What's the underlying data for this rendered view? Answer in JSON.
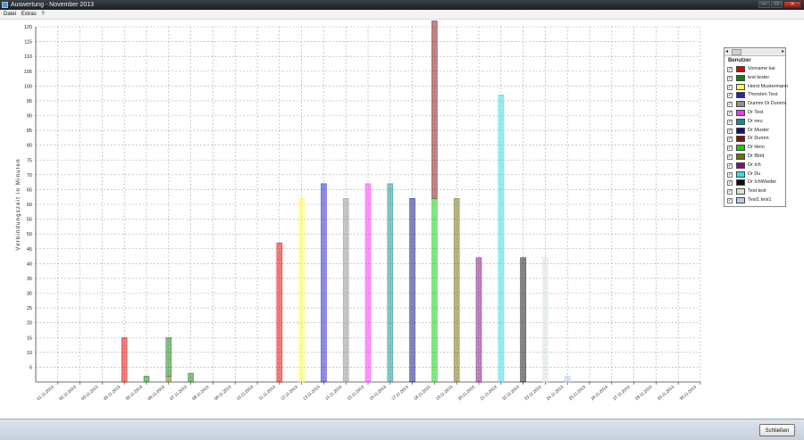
{
  "window": {
    "title": "Auswertung - November 2013",
    "buttons": {
      "minimize": "–",
      "maximize": "□",
      "close": "✕"
    }
  },
  "menu": {
    "items": [
      "Datei",
      "Extras",
      "?"
    ]
  },
  "legend": {
    "title": "Benutzer",
    "check_mark": "✓",
    "left_arrow": "◂",
    "right_arrow": "▸",
    "items": [
      {
        "name": "Vorname kai",
        "color": "#e00000"
      },
      {
        "name": "test tester",
        "color": "#108010"
      },
      {
        "name": "Horst Mustermann",
        "color": "#ffff40"
      },
      {
        "name": "Thorsten Test",
        "color": "#2020d0"
      },
      {
        "name": "Dummi Di Dummi",
        "color": "#909090"
      },
      {
        "name": "Dr Test",
        "color": "#ff30ff"
      },
      {
        "name": "Dr neu",
        "color": "#109090"
      },
      {
        "name": "Dr Muster",
        "color": "#101080"
      },
      {
        "name": "Dr Dumm",
        "color": "#801010"
      },
      {
        "name": "Dr Hein",
        "color": "#10d010"
      },
      {
        "name": "Dr Blöd",
        "color": "#707010"
      },
      {
        "name": "Dr Ich",
        "color": "#801080"
      },
      {
        "name": "Dr Du",
        "color": "#30e0e0"
      },
      {
        "name": "Dr IchWieder",
        "color": "#101010"
      },
      {
        "name": "Test test",
        "color": "#d8e4d8"
      },
      {
        "name": "Test1 test1",
        "color": "#b8cce8"
      }
    ]
  },
  "footer": {
    "close_label": "Schließen"
  },
  "chart_data": {
    "type": "bar",
    "stacked": true,
    "ylabel": "Verbindungszeit in Minuten",
    "xlabel": "",
    "ylim": [
      0,
      120
    ],
    "yticks": [
      5,
      10,
      15,
      20,
      25,
      30,
      35,
      40,
      45,
      50,
      55,
      60,
      65,
      70,
      75,
      80,
      85,
      90,
      95,
      100,
      105,
      110,
      115,
      120
    ],
    "grid": true,
    "legend_position": "right",
    "categories": [
      "01.11.2013",
      "02.11.2013",
      "03.11.2013",
      "04.11.2013",
      "05.11.2013",
      "06.11.2013",
      "07.11.2013",
      "08.11.2013",
      "09.11.2013",
      "10.11.2013",
      "11.11.2013",
      "12.11.2013",
      "13.11.2013",
      "14.11.2013",
      "15.11.2013",
      "16.11.2013",
      "17.11.2013",
      "18.11.2013",
      "19.11.2013",
      "20.11.2013",
      "21.11.2013",
      "22.11.2013",
      "23.11.2013",
      "24.11.2013",
      "25.11.2013",
      "26.11.2013",
      "27.11.2013",
      "28.11.2013",
      "29.11.2013",
      "30.11.2013"
    ],
    "bars": [
      {
        "date": "04.11.2013",
        "segments": [
          {
            "series": "Vorname kai",
            "value": 15
          }
        ]
      },
      {
        "date": "05.11.2013",
        "segments": [
          {
            "series": "test tester",
            "value": 2
          }
        ]
      },
      {
        "date": "06.11.2013",
        "segments": [
          {
            "series": "Dr Blöd",
            "value": 2
          },
          {
            "series": "test tester",
            "value": 13
          }
        ]
      },
      {
        "date": "07.11.2013",
        "segments": [
          {
            "series": "test tester",
            "value": 3
          }
        ]
      },
      {
        "date": "11.11.2013",
        "segments": [
          {
            "series": "Vorname kai",
            "value": 47
          }
        ]
      },
      {
        "date": "12.11.2013",
        "segments": [
          {
            "series": "Horst Mustermann",
            "value": 62
          }
        ]
      },
      {
        "date": "13.11.2013",
        "segments": [
          {
            "series": "Thorsten Test",
            "value": 67
          }
        ]
      },
      {
        "date": "14.11.2013",
        "segments": [
          {
            "series": "Dummi Di Dummi",
            "value": 62
          }
        ]
      },
      {
        "date": "15.11.2013",
        "segments": [
          {
            "series": "Dr Test",
            "value": 67
          }
        ]
      },
      {
        "date": "16.11.2013",
        "segments": [
          {
            "series": "Dr neu",
            "value": 67
          }
        ]
      },
      {
        "date": "17.11.2013",
        "segments": [
          {
            "series": "Dr Muster",
            "value": 62
          }
        ]
      },
      {
        "date": "18.11.2013",
        "segments": [
          {
            "series": "Dr Hein",
            "value": 62
          },
          {
            "series": "Dr Dumm",
            "value": 60
          }
        ]
      },
      {
        "date": "19.11.2013",
        "segments": [
          {
            "series": "Dr Blöd",
            "value": 62
          }
        ]
      },
      {
        "date": "20.11.2013",
        "segments": [
          {
            "series": "Dr Ich",
            "value": 42
          }
        ]
      },
      {
        "date": "21.11.2013",
        "segments": [
          {
            "series": "Dr Du",
            "value": 97
          }
        ]
      },
      {
        "date": "22.11.2013",
        "segments": [
          {
            "series": "Dr IchWieder",
            "value": 42
          }
        ]
      },
      {
        "date": "23.11.2013",
        "segments": [
          {
            "series": "Test test",
            "value": 42
          }
        ]
      },
      {
        "date": "24.11.2013",
        "segments": [
          {
            "series": "Test1 test1",
            "value": 2
          }
        ]
      }
    ]
  }
}
